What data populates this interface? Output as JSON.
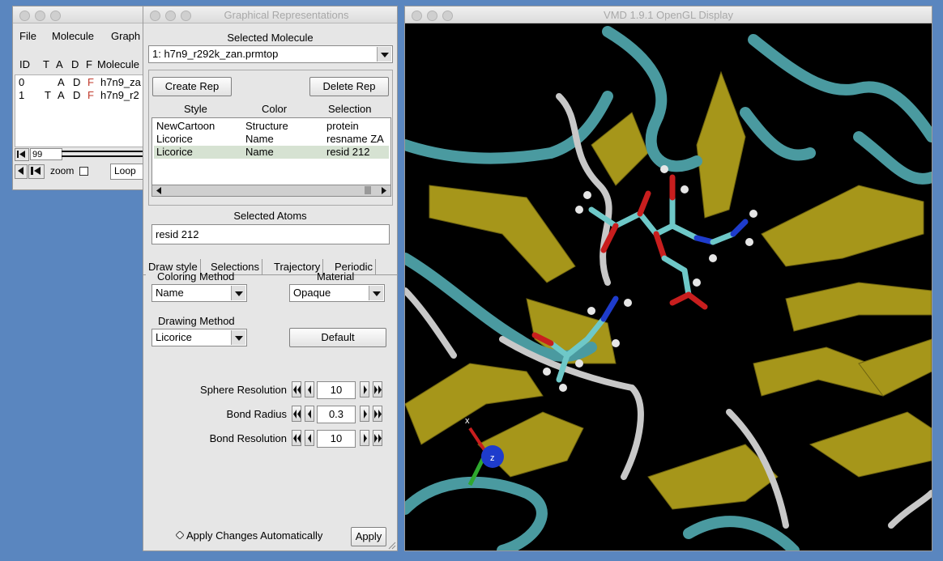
{
  "main_window": {
    "menu": [
      "File",
      "Molecule",
      "Graph"
    ],
    "columns": [
      "ID",
      "T",
      "A",
      "D",
      "F",
      "Molecule"
    ],
    "molecules": [
      {
        "id": "0",
        "t": "",
        "a": "A",
        "d": "D",
        "f": "F",
        "name": "h7n9_za"
      },
      {
        "id": "1",
        "t": "T",
        "a": "A",
        "d": "D",
        "f": "F",
        "name": "h7n9_r2"
      }
    ],
    "frame_value": "99",
    "zoom_label": "zoom",
    "loop_value": "Loop"
  },
  "rep_window": {
    "title": "Graphical Representations",
    "selected_molecule_label": "Selected Molecule",
    "selected_molecule_value": "1: h7n9_r292k_zan.prmtop",
    "create_rep_label": "Create Rep",
    "delete_rep_label": "Delete Rep",
    "reps_header": {
      "style": "Style",
      "color": "Color",
      "selection": "Selection"
    },
    "reps": [
      {
        "style": "NewCartoon",
        "color": "Structure",
        "selection": "protein"
      },
      {
        "style": "Licorice",
        "color": "Name",
        "selection": "resname ZA"
      },
      {
        "style": "Licorice",
        "color": "Name",
        "selection": "resid 212"
      }
    ],
    "selected_rep_index": 2,
    "selected_atoms_label": "Selected Atoms",
    "selected_atoms_value": "resid 212",
    "tabs": [
      "Draw style",
      "Selections",
      "Trajectory",
      "Periodic"
    ],
    "coloring_method_label": "Coloring Method",
    "coloring_method_value": "Name",
    "material_label": "Material",
    "material_value": "Opaque",
    "drawing_method_label": "Drawing Method",
    "drawing_method_value": "Licorice",
    "default_label": "Default",
    "sphere_resolution_label": "Sphere Resolution",
    "sphere_resolution_value": "10",
    "bond_radius_label": "Bond Radius",
    "bond_radius_value": "0.3",
    "bond_resolution_label": "Bond Resolution",
    "bond_resolution_value": "10",
    "apply_auto_label": "Apply Changes Automatically",
    "apply_label": "Apply"
  },
  "display_window": {
    "title": "VMD 1.9.1 OpenGL Display",
    "axis_x_label": "x",
    "axis_z_label": "z",
    "colors": {
      "background": "#000000",
      "ribbon_cyan": "#4a9aa0",
      "sheet_yellow": "#a6961a",
      "coil_white": "#c8c8c8",
      "oxygen": "#c81e1e",
      "nitrogen": "#1e3ccc",
      "carbon": "#6ec8c8",
      "hydrogen": "#e6e6e6"
    }
  }
}
